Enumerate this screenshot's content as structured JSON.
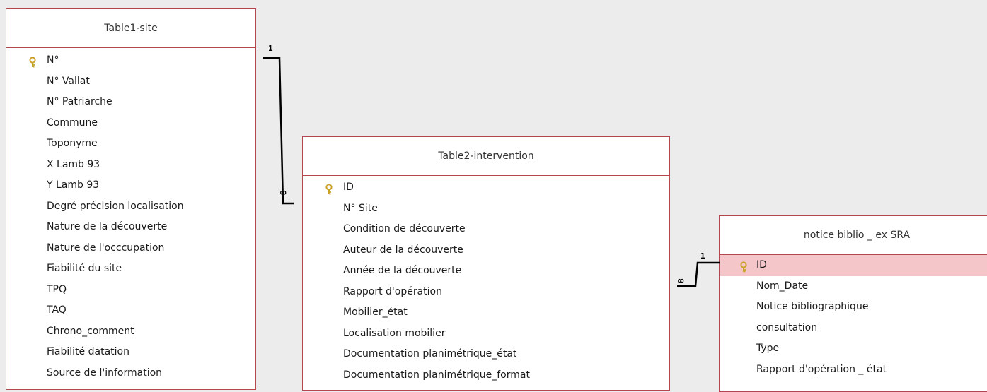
{
  "tables": [
    {
      "title": "Table1-site",
      "fields": [
        {
          "label": "N°",
          "key": true
        },
        {
          "label": "N° Vallat"
        },
        {
          "label": "N° Patriarche"
        },
        {
          "label": "Commune"
        },
        {
          "label": "Toponyme"
        },
        {
          "label": "X Lamb 93"
        },
        {
          "label": "Y Lamb 93"
        },
        {
          "label": "Degré précision localisation"
        },
        {
          "label": "Nature de la découverte"
        },
        {
          "label": "Nature de l'occcupation"
        },
        {
          "label": "Fiabilité du site"
        },
        {
          "label": "TPQ"
        },
        {
          "label": "TAQ"
        },
        {
          "label": "Chrono_comment"
        },
        {
          "label": "Fiabilité datation"
        },
        {
          "label": "Source de l'information"
        }
      ]
    },
    {
      "title": "Table2-intervention",
      "fields": [
        {
          "label": "ID",
          "key": true
        },
        {
          "label": "N° Site"
        },
        {
          "label": "Condition de découverte"
        },
        {
          "label": "Auteur de la découverte"
        },
        {
          "label": "Année de la découverte"
        },
        {
          "label": "Rapport d'opération"
        },
        {
          "label": "Mobilier_état"
        },
        {
          "label": "Localisation mobilier"
        },
        {
          "label": "Documentation planimétrique_état"
        },
        {
          "label": "Documentation planimétrique_format"
        }
      ]
    },
    {
      "title": "notice biblio _ ex SRA",
      "fields": [
        {
          "label": "ID",
          "key": true,
          "selected": true
        },
        {
          "label": "Nom_Date"
        },
        {
          "label": "Notice bibliographique"
        },
        {
          "label": "consultation"
        },
        {
          "label": "Type"
        },
        {
          "label": "Rapport d'opération _ état"
        }
      ]
    }
  ],
  "relationships": {
    "r1": {
      "one": "1",
      "many": "∞"
    },
    "r2": {
      "one": "1",
      "many": "∞"
    }
  },
  "colors": {
    "background": "#ececec",
    "border": "#b3474d",
    "selected_row": "#f5c6c9",
    "key_icon": "#c9a227"
  }
}
